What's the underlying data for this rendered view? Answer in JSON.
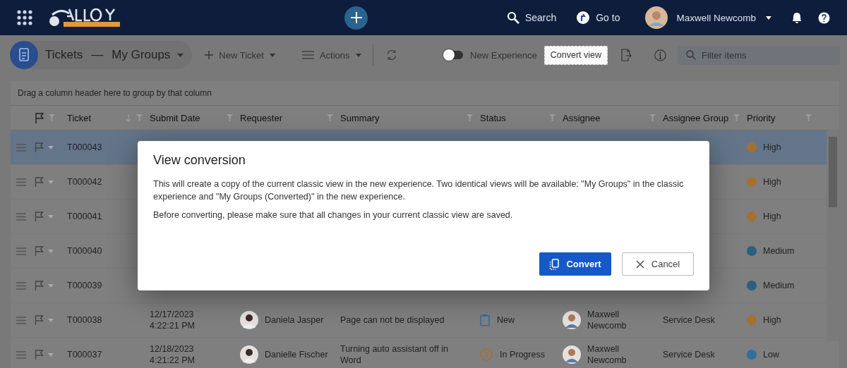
{
  "topbar": {
    "search": "Search",
    "goto": "Go to",
    "user": "Maxwell Newcomb"
  },
  "toolbar": {
    "title": "Tickets",
    "separator": "—",
    "view": "My Groups",
    "new_ticket": "New Ticket",
    "actions": "Actions",
    "toggle": {
      "label": "New Experience",
      "on": false
    },
    "convert_view": "Convert view",
    "filter": {
      "placeholder": "Filter items"
    }
  },
  "group_hint": "Drag a column header here to group by that column",
  "columns": [
    {
      "label": "Ticket",
      "sorted": true
    },
    {
      "label": "Submit Date",
      "sorted": false
    },
    {
      "label": "Requester",
      "sorted": false
    },
    {
      "label": "Summary",
      "sorted": false
    },
    {
      "label": "Status",
      "sorted": false
    },
    {
      "label": "Assignee",
      "sorted": false
    },
    {
      "label": "Assignee Group",
      "sorted": false
    },
    {
      "label": "Priority",
      "sorted": false
    }
  ],
  "rows": [
    {
      "ticket": "T000043",
      "priority": "High",
      "color": "#a5702f",
      "selected": true
    },
    {
      "ticket": "T000042",
      "priority": "High",
      "color": "#a5702f",
      "selected": false
    },
    {
      "ticket": "T000041",
      "priority": "High",
      "color": "#a5702f",
      "selected": false
    },
    {
      "ticket": "T000040",
      "priority": "Medium",
      "color": "#2a5f80",
      "selected": false
    },
    {
      "ticket": "T000039",
      "priority": "Medium",
      "color": "#2a5f80",
      "selected": false
    },
    {
      "ticket": "T000038",
      "date": "12/17/2023",
      "time": "4:22:21 PM",
      "requester": "Daniela Jasper",
      "summary": "Page can not be displayed",
      "status": {
        "kind": "new",
        "label": "New"
      },
      "assignee": "Maxwell Newcomb",
      "group": "Service Desk",
      "priority": "High",
      "color": "#a5702f",
      "selected": false
    },
    {
      "ticket": "T000037",
      "date": "12/18/2023",
      "time": "4:21:22 PM",
      "requester": "Danielle Fischer",
      "summary": "Turning auto assistant off in Word",
      "status": {
        "kind": "in_progress",
        "label": "In Progress"
      },
      "assignee": "Maxwell Newcomb",
      "group": "Service Desk",
      "priority": "Low",
      "color": "#2f6f9c",
      "selected": false
    }
  ],
  "dialog": {
    "title": "View conversion",
    "paragraphs": [
      "This will create a copy of the current classic view in the new experience. Two identical views will be available: \"My Groups\" in the classic experience and \"My Groups (Converted)\" in the new experience.",
      "Before converting, please make sure that all changes in your current classic view are saved."
    ],
    "buttons": [
      {
        "kind": "primary",
        "label": "Convert"
      },
      {
        "kind": "cancel",
        "label": "Cancel"
      }
    ]
  }
}
